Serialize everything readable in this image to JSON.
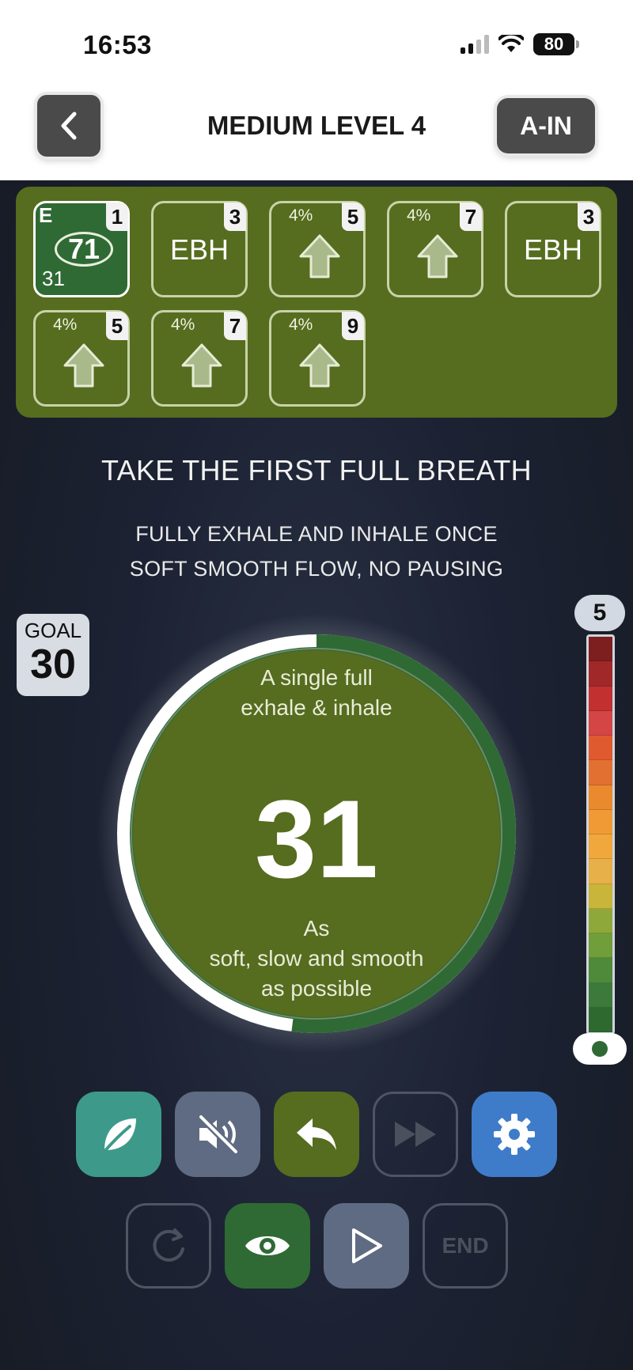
{
  "status_bar": {
    "time": "16:53",
    "battery": "80"
  },
  "header": {
    "title": "MEDIUM LEVEL 4",
    "back_icon": "chevron-left-icon",
    "mode_button": "A-IN"
  },
  "steps": [
    {
      "type": "breath",
      "letter": "E",
      "value": "71",
      "sub": "31",
      "number": "1",
      "active": true
    },
    {
      "type": "ebh",
      "label": "EBH",
      "number": "3"
    },
    {
      "type": "arrow",
      "percent": "4%",
      "number": "5"
    },
    {
      "type": "arrow",
      "percent": "4%",
      "number": "7"
    },
    {
      "type": "ebh",
      "label": "EBH",
      "number": "3"
    },
    {
      "type": "arrow",
      "percent": "4%",
      "number": "5"
    },
    {
      "type": "arrow",
      "percent": "4%",
      "number": "7"
    },
    {
      "type": "arrow",
      "percent": "4%",
      "number": "9"
    }
  ],
  "instructions": {
    "main": "TAKE THE FIRST FULL BREATH",
    "line1": "FULLY EXHALE AND INHALE ONCE",
    "line2": "SOFT SMOOTH FLOW, NO PAUSING"
  },
  "goal": {
    "label": "GOAL",
    "value": "30"
  },
  "dial": {
    "top_line1": "A single full",
    "top_line2": "exhale & inhale",
    "count": "31",
    "bottom_line1": "As",
    "bottom_line2": "soft, slow and smooth",
    "bottom_line3": "as possible",
    "progress": 0.48
  },
  "scale": {
    "badge": "5",
    "level": 0.0,
    "colors": [
      "#7d1f1f",
      "#a02828",
      "#c23030",
      "#d44545",
      "#e05a30",
      "#e27030",
      "#ea8a2e",
      "#f09a35",
      "#f0a83c",
      "#e8b048",
      "#c9b53a",
      "#8fa83a",
      "#6f9e3a",
      "#4f8a3a",
      "#3b7a3a",
      "#2e6a30"
    ]
  },
  "controls": {
    "row1": [
      "leaf-icon",
      "mute-icon",
      "reply-icon",
      "fast-forward-icon",
      "gear-icon"
    ],
    "row2": [
      "restart-icon",
      "eye-icon",
      "play-icon",
      "END"
    ]
  },
  "theme": {
    "panel": "#566c1f",
    "ring": "#2f6a34",
    "accent_blue": "#3e7cc9",
    "teal": "#3d9a8a"
  }
}
